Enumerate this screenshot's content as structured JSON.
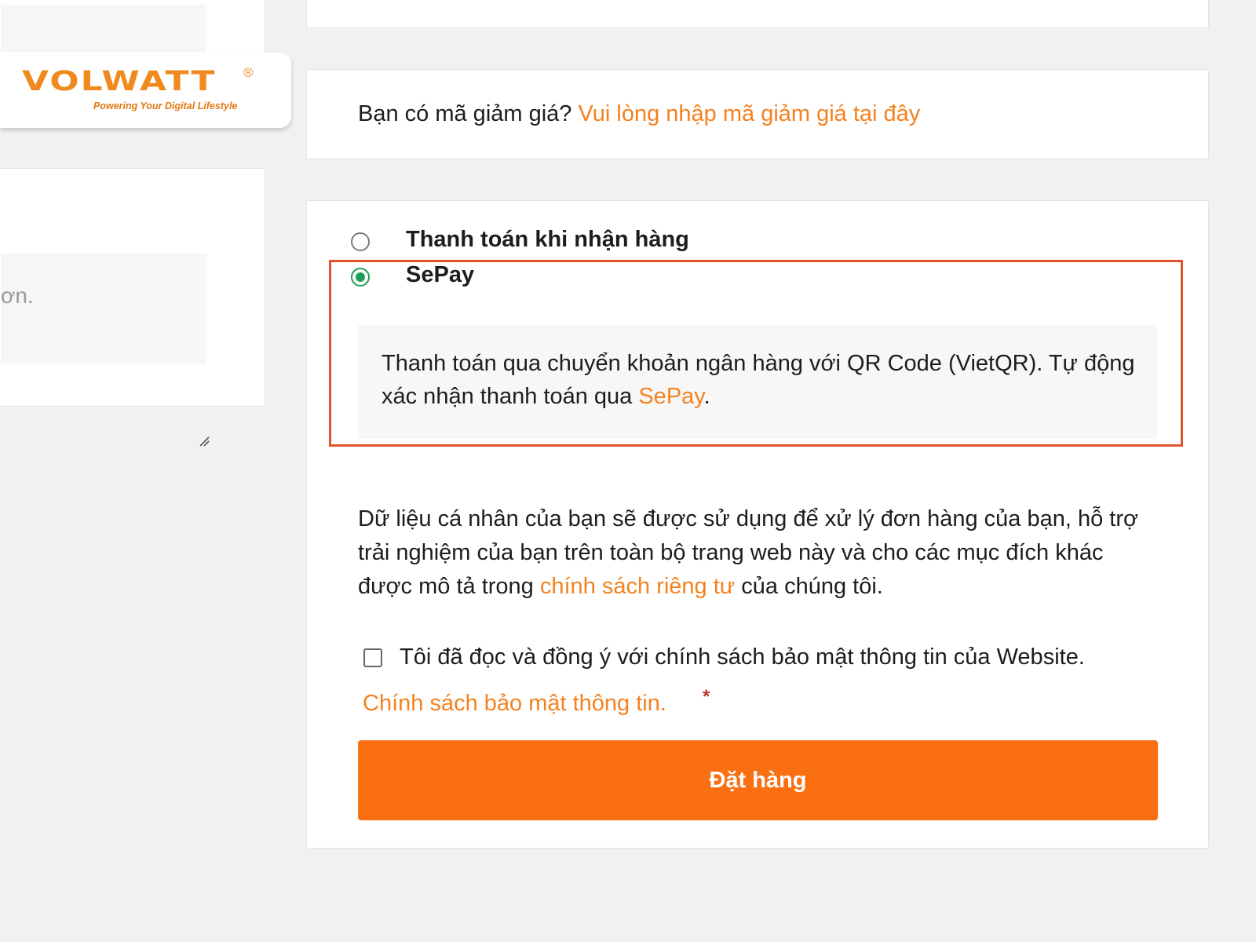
{
  "brand": {
    "name": "VOLWATT",
    "registered_mark": "®",
    "tagline": "Powering Your Digital Lifestyle",
    "color": "#f08a1e"
  },
  "notes": {
    "placeholder_fragment": "ơn."
  },
  "coupon": {
    "prompt": "Bạn có mã giảm giá?",
    "link": "Vui lòng nhập mã giảm giá tại đây"
  },
  "payment": {
    "methods": [
      {
        "label": "Thanh toán khi nhận hàng",
        "selected": false
      },
      {
        "label": "SePay",
        "selected": true
      }
    ],
    "sepay_description": {
      "text": "Thanh toán qua chuyển khoản ngân hàng với QR Code (VietQR). Tự động xác nhận thanh toán qua",
      "link": "SePay",
      "suffix": "."
    }
  },
  "privacy": {
    "text_before": "Dữ liệu cá nhân của bạn sẽ được sử dụng để xử lý đơn hàng của bạn, hỗ trợ trải nghiệm của bạn trên toàn bộ trang web này và cho các mục đích khác được mô tả trong",
    "link": "chính sách riêng tư",
    "text_after": "của chúng tôi."
  },
  "agreement": {
    "label": "Tôi đã đọc và đồng ý với chính sách bảo mật thông tin của Website.",
    "policy_link": "Chính sách bảo mật thông tin.",
    "required_mark": "*",
    "checked": false
  },
  "submit": {
    "label": "Đặt hàng"
  },
  "colors": {
    "accent": "#f5811f",
    "button": "#f96f12",
    "radio_selected": "#1f9d55",
    "highlight_border": "#e1542b"
  }
}
